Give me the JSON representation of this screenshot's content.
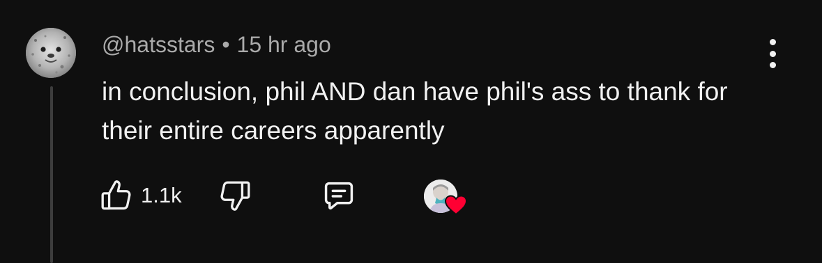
{
  "comment": {
    "username": "@hatsstars",
    "separator": "•",
    "time": "15 hr ago",
    "text": "in conclusion, phil AND dan have phil's ass to thank for their entire careers apparently"
  },
  "actions": {
    "like_count": "1.1k"
  },
  "icons": {
    "avatar": "seal-avatar",
    "menu": "vertical-dots-icon",
    "like": "thumbs-up-icon",
    "dislike": "thumbs-down-icon",
    "reply": "comment-icon",
    "creator_heart": "creator-heart-icon"
  },
  "colors": {
    "background": "#0f0f0f",
    "text_primary": "#f1f1f1",
    "text_secondary": "#aaaaaa",
    "heart": "#ff0033"
  }
}
